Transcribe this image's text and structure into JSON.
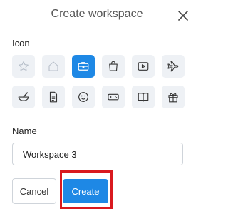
{
  "dialog": {
    "title": "Create workspace",
    "close_icon": "close-icon"
  },
  "icon_section": {
    "label": "Icon",
    "icons": [
      {
        "name": "star-icon",
        "selected": false
      },
      {
        "name": "home-icon",
        "selected": false
      },
      {
        "name": "briefcase-icon",
        "selected": true
      },
      {
        "name": "shopping-bag-icon",
        "selected": false
      },
      {
        "name": "video-icon",
        "selected": false
      },
      {
        "name": "airplane-icon",
        "selected": false
      },
      {
        "name": "mortar-pestle-icon",
        "selected": false
      },
      {
        "name": "document-icon",
        "selected": false
      },
      {
        "name": "smiley-icon",
        "selected": false
      },
      {
        "name": "gamepad-icon",
        "selected": false
      },
      {
        "name": "book-icon",
        "selected": false
      },
      {
        "name": "gift-icon",
        "selected": false
      }
    ]
  },
  "name_section": {
    "label": "Name",
    "value": "Workspace 3"
  },
  "buttons": {
    "cancel_label": "Cancel",
    "create_label": "Create"
  },
  "colors": {
    "accent": "#1e88e5",
    "tile_bg": "#eef1f5",
    "highlight": "#d9191f"
  }
}
